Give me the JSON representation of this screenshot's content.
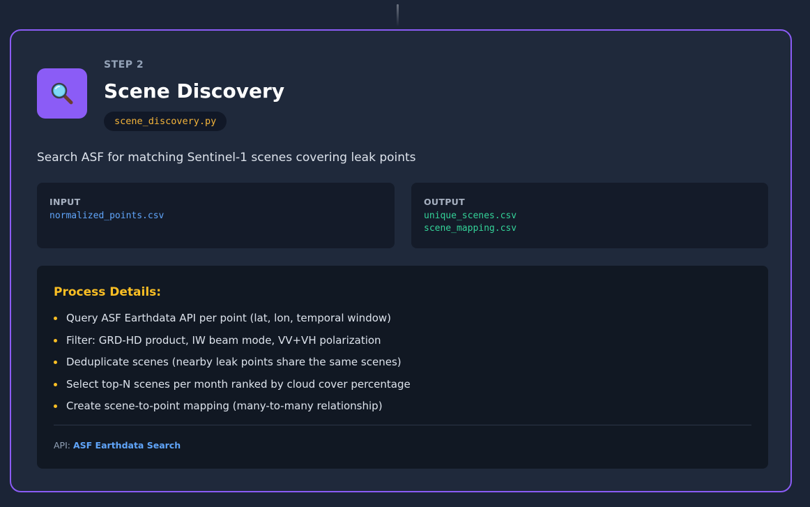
{
  "step": {
    "label": "STEP 2",
    "title": "Scene Discovery",
    "icon": "magnifying-glass-icon",
    "script_file": "scene_discovery.py",
    "description": "Search ASF for matching Sentinel-1 scenes covering leak points"
  },
  "input": {
    "heading": "INPUT",
    "files": [
      "normalized_points.csv"
    ]
  },
  "output": {
    "heading": "OUTPUT",
    "files": [
      "unique_scenes.csv",
      "scene_mapping.csv"
    ]
  },
  "process": {
    "title": "Process Details:",
    "items": [
      "Query ASF Earthdata API per point (lat, lon, temporal window)",
      "Filter: GRD-HD product, IW beam mode, VV+VH polarization",
      "Deduplicate scenes (nearby leak points share the same scenes)",
      "Select top-N scenes per month ranked by cloud cover percentage",
      "Create scene-to-point mapping (many-to-many relationship)"
    ],
    "api_label": "API:",
    "api_link": "ASF Earthdata Search"
  },
  "colors": {
    "accent": "#8b5cf6",
    "highlight": "#fbbf24",
    "input_file": "#60a5fa",
    "output_file": "#34d399",
    "background": "#1b2436",
    "card": "#1f293b"
  }
}
